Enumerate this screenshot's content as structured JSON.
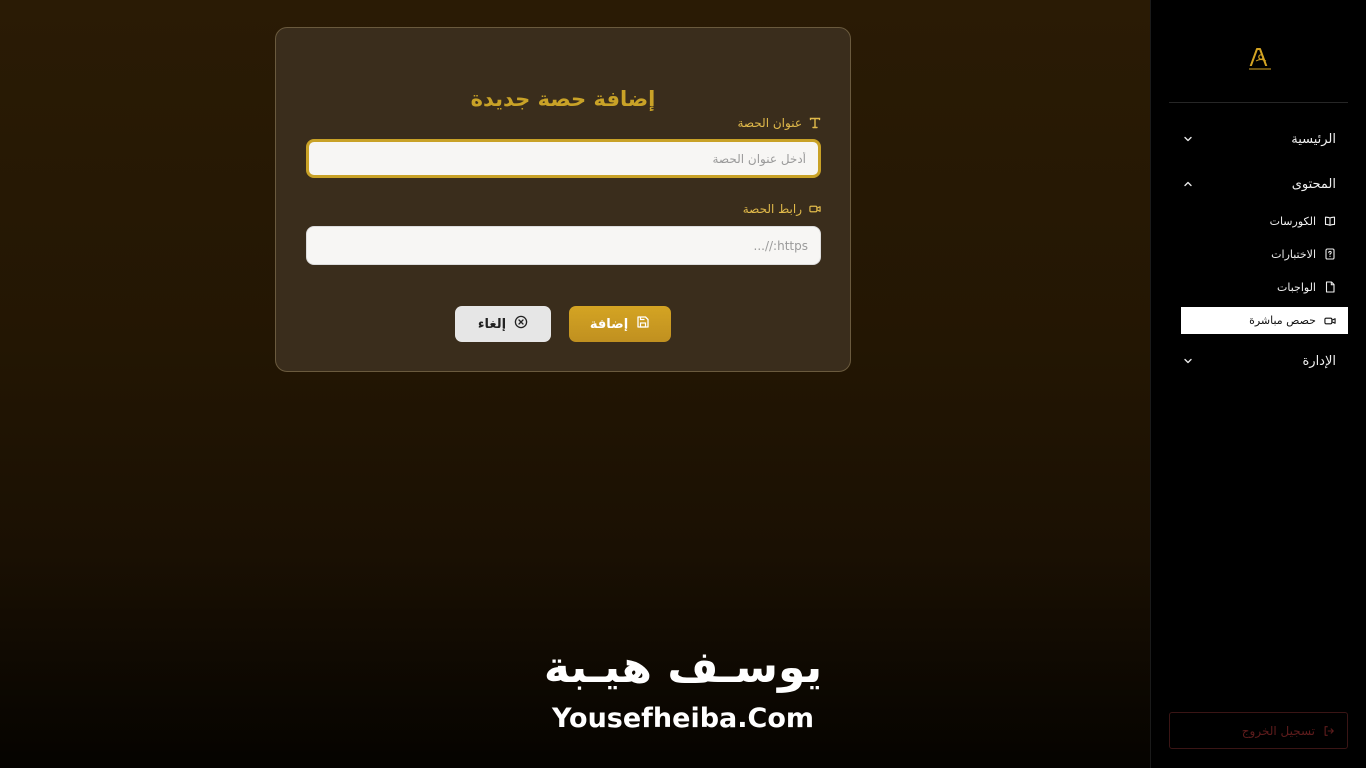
{
  "form": {
    "title": "إضافة حصة جديدة",
    "title_label": "عنوان الحصة",
    "title_placeholder": "أدخل عنوان الحصة",
    "title_value": "",
    "url_label": "رابط الحصة",
    "url_placeholder": "https://...",
    "url_value": "",
    "add_button": "إضافة",
    "cancel_button": "إلغاء"
  },
  "brand": {
    "arabic": "يوسـف هيـبة",
    "english": "Yousefheiba.Com"
  },
  "sidebar": {
    "logo_icon": "brand-logo-icon",
    "items": [
      {
        "label": "الرئيسية",
        "expanded": false
      },
      {
        "label": "المحتوى",
        "expanded": true
      },
      {
        "label": "الإدارة",
        "expanded": false
      }
    ],
    "sub_items": [
      {
        "label": "الكورسات",
        "icon": "book-open-icon"
      },
      {
        "label": "الاختبارات",
        "icon": "file-question-icon"
      },
      {
        "label": "الواجبات",
        "icon": "file-icon"
      },
      {
        "label": "حصص مباشرة",
        "icon": "video-icon",
        "active": true
      }
    ],
    "logout": "تسجيل الخروج"
  },
  "colors": {
    "accent_gold": "#c9a227",
    "card_bg": "#3a2d1c",
    "sidebar_bg": "#000000",
    "logout_red": "#5e1c1c"
  }
}
